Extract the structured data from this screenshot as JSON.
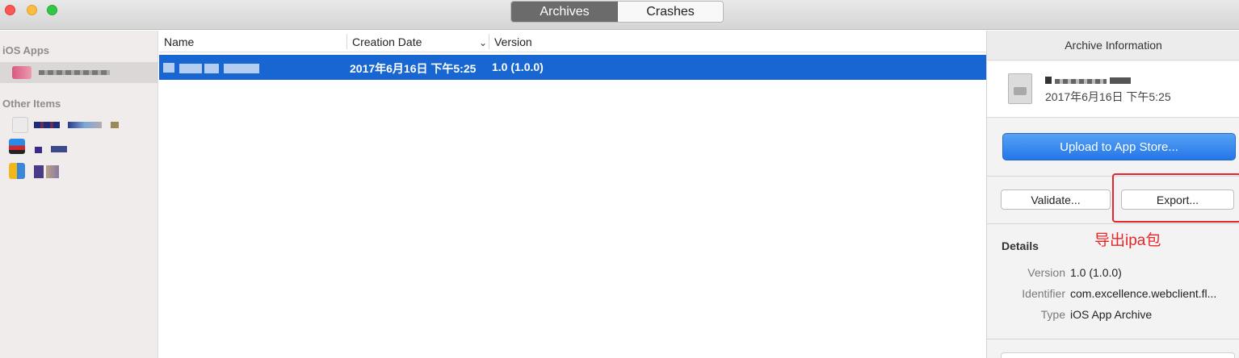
{
  "toolbar": {
    "tabs": [
      {
        "label": "Archives",
        "active": true
      },
      {
        "label": "Crashes",
        "active": false
      }
    ]
  },
  "sidebar": {
    "sections": [
      {
        "title": "iOS Apps"
      },
      {
        "title": "Other Items"
      }
    ]
  },
  "list": {
    "columns": [
      "Name",
      "Creation Date",
      "Version"
    ],
    "rows": [
      {
        "date": "2017年6月16日 下午5:25",
        "version": "1.0 (1.0.0)",
        "selected": true
      }
    ]
  },
  "inspector": {
    "title": "Archive Information",
    "archive_date": "2017年6月16日 下午5:25",
    "upload_label": "Upload to App Store...",
    "validate_label": "Validate...",
    "export_label": "Export...",
    "annotation": "导出ipa包",
    "details_heading": "Details",
    "details": [
      {
        "label": "Version",
        "value": "1.0 (1.0.0)"
      },
      {
        "label": "Identifier",
        "value": "com.excellence.webclient.fl..."
      },
      {
        "label": "Type",
        "value": "iOS App Archive"
      }
    ]
  },
  "colors": {
    "selection": "#1766d2",
    "accent_button": "#2476e8",
    "annotation": "#e8252a"
  }
}
